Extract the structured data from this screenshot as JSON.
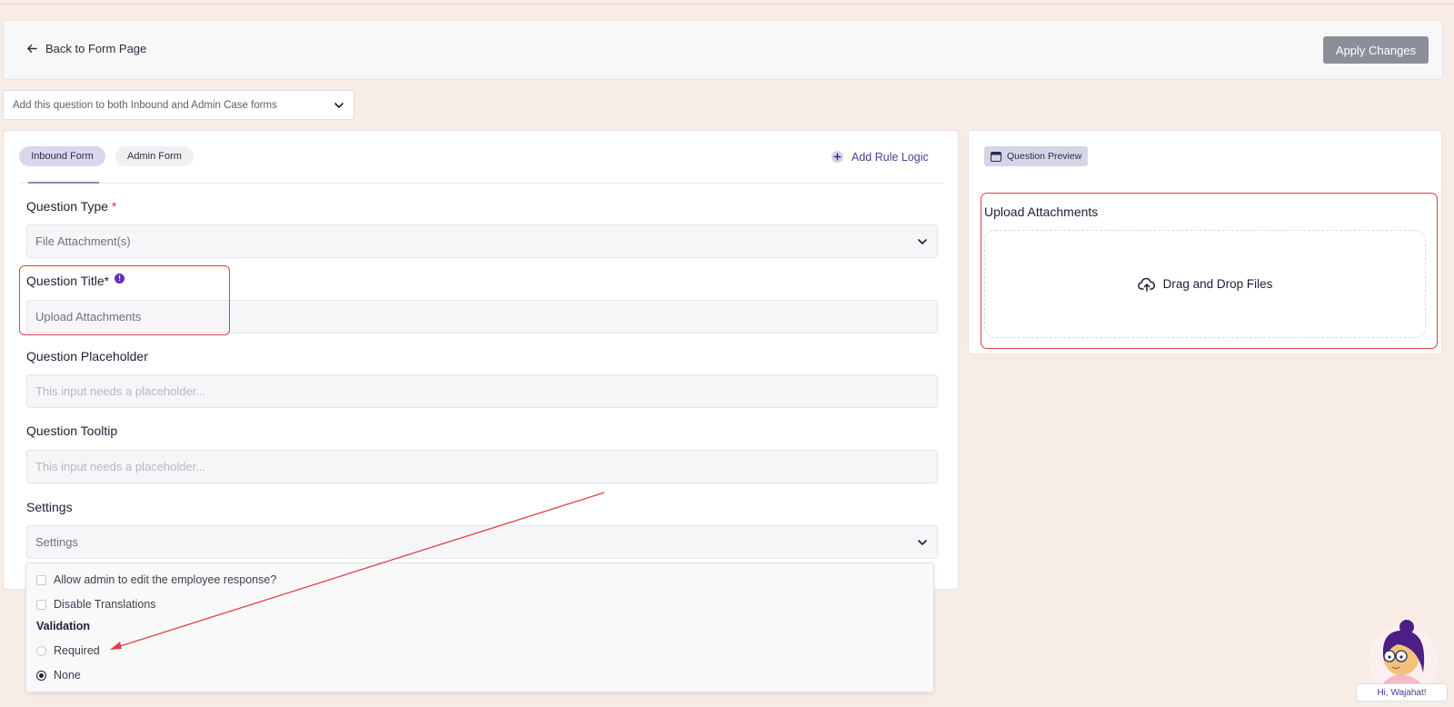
{
  "header": {
    "back_label": "Back to Form Page",
    "apply_label": "Apply Changes"
  },
  "scope_select": {
    "value": "Add this question to both Inbound and Admin Case forms"
  },
  "editor": {
    "tabs": [
      {
        "label": "Inbound Form",
        "active": true
      },
      {
        "label": "Admin Form",
        "active": false
      }
    ],
    "add_rule_label": "Add Rule Logic",
    "question_type": {
      "label": "Question Type",
      "required_mark": "*",
      "value": "File Attachment(s)"
    },
    "question_title": {
      "label": "Question Title*",
      "value": "Upload Attachments"
    },
    "question_placeholder": {
      "label": "Question Placeholder",
      "placeholder": "This input needs a placeholder..."
    },
    "question_tooltip": {
      "label": "Question Tooltip",
      "placeholder": "This input needs a placeholder..."
    },
    "settings": {
      "label": "Settings",
      "value": "Settings",
      "options": [
        {
          "label": "Allow admin to edit the employee response?",
          "checked": false
        },
        {
          "label": "Disable Translations",
          "checked": false
        }
      ],
      "validation_heading": "Validation",
      "validation_options": [
        {
          "label": "Required",
          "selected": false
        },
        {
          "label": "None",
          "selected": true
        }
      ]
    }
  },
  "preview": {
    "badge_label": "Question Preview",
    "title": "Upload Attachments",
    "dropzone_label": "Drag and Drop Files"
  },
  "assistant": {
    "greeting": "Hi, Wajahat!"
  },
  "colors": {
    "page_bg": "#f7ece6",
    "accent": "#4f3e8f",
    "highlight": "#e0414a",
    "apply_button": "#8b8f99"
  }
}
